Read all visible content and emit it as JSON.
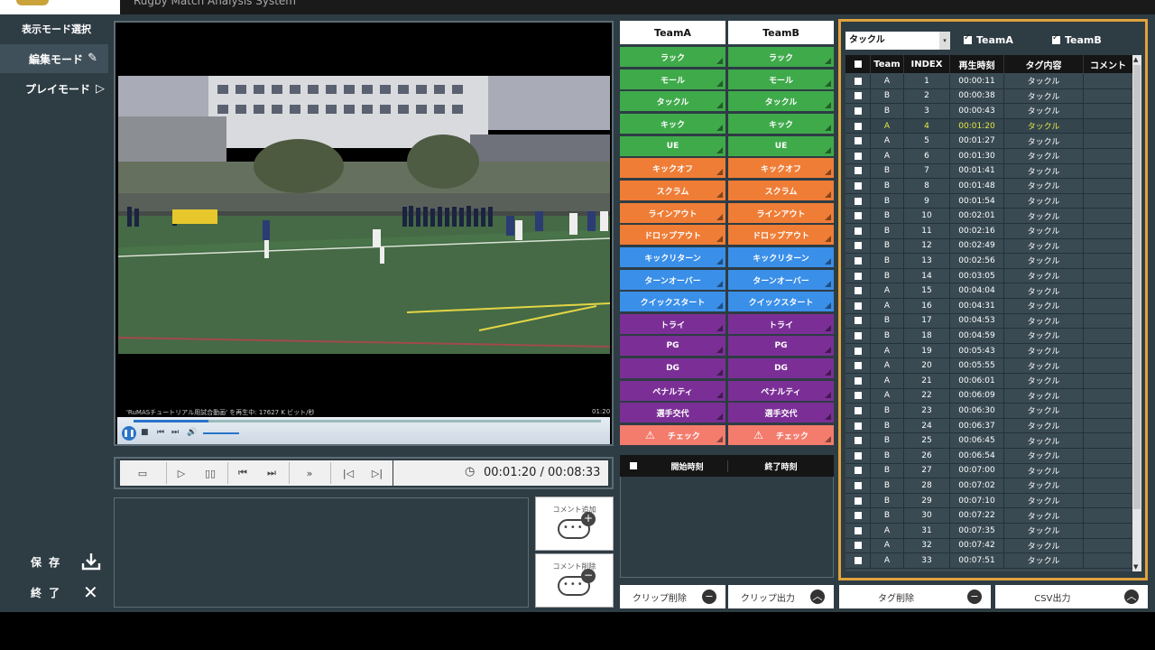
{
  "header": {
    "title": "Rugby Match Analysis System"
  },
  "sidebar": {
    "mode_select_title": "表示モード選択",
    "edit_mode": "編集モード",
    "play_mode": "プレイモード",
    "save": "保 存",
    "quit": "終 了"
  },
  "video": {
    "status_text": "'RuMASチュートリアル用試合動画' を再生中: 17627 K ビット/秒",
    "time_small": "01:20",
    "progress": 0.16
  },
  "transport": {
    "time": "00:01:20 / 00:08:33"
  },
  "comments": {
    "add": "コメント追加",
    "delete": "コメント削除"
  },
  "tags": {
    "team_a": "TeamA",
    "team_b": "TeamB",
    "buttons": [
      {
        "label": "ラック",
        "color": "#3faa4a"
      },
      {
        "label": "モール",
        "color": "#3faa4a"
      },
      {
        "label": "タックル",
        "color": "#3faa4a"
      },
      {
        "label": "キック",
        "color": "#3faa4a"
      },
      {
        "label": "UE",
        "color": "#3faa4a"
      },
      {
        "label": "キックオフ",
        "color": "#ef7d36"
      },
      {
        "label": "スクラム",
        "color": "#ef7d36"
      },
      {
        "label": "ラインアウト",
        "color": "#ef7d36"
      },
      {
        "label": "ドロップアウト",
        "color": "#ef7d36"
      },
      {
        "label": "キックリターン",
        "color": "#3a8fe8"
      },
      {
        "label": "ターンオーバー",
        "color": "#3a8fe8"
      },
      {
        "label": "クイックスタート",
        "color": "#3a8fe8"
      },
      {
        "label": "トライ",
        "color": "#7b2f96"
      },
      {
        "label": "PG",
        "color": "#7b2f96"
      },
      {
        "label": "DG",
        "color": "#7b2f96"
      },
      {
        "label": "ペナルティ",
        "color": "#7b2f96"
      },
      {
        "label": "選手交代",
        "color": "#7b2f96"
      },
      {
        "label": "チェック",
        "color": "#f37c6d"
      }
    ]
  },
  "clips": {
    "start_header": "開始時刻",
    "end_header": "終了時刻",
    "delete": "クリップ削除",
    "export": "クリップ出力"
  },
  "tag_list": {
    "filter": "タックル",
    "team_a": "TeamA",
    "team_b": "TeamB",
    "headers": [
      "Team",
      "INDEX",
      "再生時刻",
      "タグ内容",
      "コメント"
    ],
    "rows": [
      [
        "A",
        "1",
        "00:00:11",
        "タックル"
      ],
      [
        "B",
        "2",
        "00:00:38",
        "タックル"
      ],
      [
        "B",
        "3",
        "00:00:43",
        "タックル"
      ],
      [
        "A",
        "4",
        "00:01:20",
        "タックル"
      ],
      [
        "A",
        "5",
        "00:01:27",
        "タックル"
      ],
      [
        "A",
        "6",
        "00:01:30",
        "タックル"
      ],
      [
        "B",
        "7",
        "00:01:41",
        "タックル"
      ],
      [
        "B",
        "8",
        "00:01:48",
        "タックル"
      ],
      [
        "B",
        "9",
        "00:01:54",
        "タックル"
      ],
      [
        "B",
        "10",
        "00:02:01",
        "タックル"
      ],
      [
        "B",
        "11",
        "00:02:16",
        "タックル"
      ],
      [
        "B",
        "12",
        "00:02:49",
        "タックル"
      ],
      [
        "B",
        "13",
        "00:02:56",
        "タックル"
      ],
      [
        "B",
        "14",
        "00:03:05",
        "タックル"
      ],
      [
        "A",
        "15",
        "00:04:04",
        "タックル"
      ],
      [
        "A",
        "16",
        "00:04:31",
        "タックル"
      ],
      [
        "B",
        "17",
        "00:04:53",
        "タックル"
      ],
      [
        "B",
        "18",
        "00:04:59",
        "タックル"
      ],
      [
        "A",
        "19",
        "00:05:43",
        "タックル"
      ],
      [
        "A",
        "20",
        "00:05:55",
        "タックル"
      ],
      [
        "A",
        "21",
        "00:06:01",
        "タックル"
      ],
      [
        "A",
        "22",
        "00:06:09",
        "タックル"
      ],
      [
        "B",
        "23",
        "00:06:30",
        "タックル"
      ],
      [
        "B",
        "24",
        "00:06:37",
        "タックル"
      ],
      [
        "B",
        "25",
        "00:06:45",
        "タックル"
      ],
      [
        "B",
        "26",
        "00:06:54",
        "タックル"
      ],
      [
        "B",
        "27",
        "00:07:00",
        "タックル"
      ],
      [
        "B",
        "28",
        "00:07:02",
        "タックル"
      ],
      [
        "B",
        "29",
        "00:07:10",
        "タックル"
      ],
      [
        "B",
        "30",
        "00:07:22",
        "タックル"
      ],
      [
        "A",
        "31",
        "00:07:35",
        "タックル"
      ],
      [
        "A",
        "32",
        "00:07:42",
        "タックル"
      ],
      [
        "A",
        "33",
        "00:07:51",
        "タックル"
      ]
    ],
    "highlight_index": "4",
    "delete": "タグ削除",
    "export": "CSV出力"
  }
}
